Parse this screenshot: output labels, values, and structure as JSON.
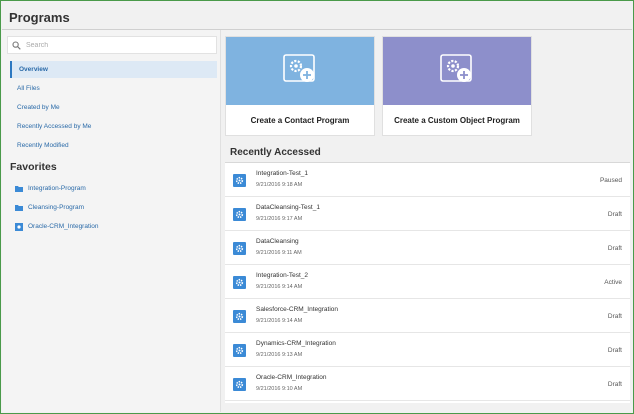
{
  "page": {
    "title": "Programs"
  },
  "search": {
    "placeholder": "Search"
  },
  "nav": {
    "items": [
      {
        "label": "Overview"
      },
      {
        "label": "All Files"
      },
      {
        "label": "Created by Me"
      },
      {
        "label": "Recently Accessed by Me"
      },
      {
        "label": "Recently Modified"
      }
    ]
  },
  "favorites": {
    "title": "Favorites",
    "items": [
      {
        "label": "Integration-Program",
        "icon": "folder-icon"
      },
      {
        "label": "Cleansing-Program",
        "icon": "folder-icon"
      },
      {
        "label": "Oracle-CRM_Integration",
        "icon": "program-icon"
      }
    ]
  },
  "cards": [
    {
      "label": "Create a Contact Program",
      "color": "#7fb3e0",
      "icon": "gear-plus-icon"
    },
    {
      "label": "Create a Custom Object Program",
      "color": "#8d8fcb",
      "icon": "gear-plus-icon"
    }
  ],
  "recent": {
    "title": "Recently Accessed",
    "rows": [
      {
        "name": "Integration-Test_1",
        "date": "9/21/2016 9:18 AM",
        "status": "Paused"
      },
      {
        "name": "DataCleansing-Test_1",
        "date": "9/21/2016 9:17 AM",
        "status": "Draft"
      },
      {
        "name": "DataCleansing",
        "date": "9/21/2016 9:11 AM",
        "status": "Draft"
      },
      {
        "name": "Integration-Test_2",
        "date": "9/21/2016 9:14 AM",
        "status": "Active"
      },
      {
        "name": "Salesforce-CRM_Integration",
        "date": "9/21/2016 9:14 AM",
        "status": "Draft"
      },
      {
        "name": "Dynamics-CRM_Integration",
        "date": "9/21/2016 9:13 AM",
        "status": "Draft"
      },
      {
        "name": "Oracle-CRM_Integration",
        "date": "9/21/2016 9:10 AM",
        "status": "Draft"
      }
    ]
  },
  "colors": {
    "accent": "#2d78c0",
    "link": "#2a6aa8",
    "frame": "#4a9a4a"
  }
}
